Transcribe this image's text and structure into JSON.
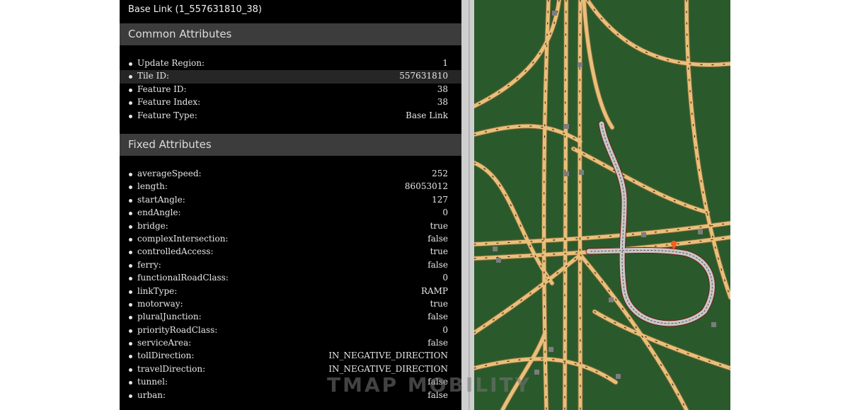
{
  "panel": {
    "title": "Base Link (1_557631810_38)",
    "common_section": "Common Attributes",
    "fixed_section": "Fixed Attributes",
    "common_attributes": [
      {
        "key": "Update Region:",
        "value": "1"
      },
      {
        "key": "Tile ID:",
        "value": "557631810"
      },
      {
        "key": "Feature ID:",
        "value": "38"
      },
      {
        "key": "Feature Index:",
        "value": "38"
      },
      {
        "key": "Feature Type:",
        "value": "Base Link"
      }
    ],
    "fixed_attributes": [
      {
        "key": "averageSpeed:",
        "value": "252"
      },
      {
        "key": "length:",
        "value": "86053012"
      },
      {
        "key": "startAngle:",
        "value": "127"
      },
      {
        "key": "endAngle:",
        "value": "0"
      },
      {
        "key": "bridge:",
        "value": "true"
      },
      {
        "key": "complexIntersection:",
        "value": "false"
      },
      {
        "key": "controlledAccess:",
        "value": "true"
      },
      {
        "key": "ferry:",
        "value": "false"
      },
      {
        "key": "functionalRoadClass:",
        "value": "0"
      },
      {
        "key": "linkType:",
        "value": "RAMP"
      },
      {
        "key": "motorway:",
        "value": "true"
      },
      {
        "key": "pluralJunction:",
        "value": "false"
      },
      {
        "key": "priorityRoadClass:",
        "value": "0"
      },
      {
        "key": "serviceArea:",
        "value": "false"
      },
      {
        "key": "tollDirection:",
        "value": "IN_NEGATIVE_DIRECTION"
      },
      {
        "key": "travelDirection:",
        "value": "IN_NEGATIVE_DIRECTION"
      },
      {
        "key": "tunnel:",
        "value": "false"
      },
      {
        "key": "urban:",
        "value": "false"
      }
    ]
  },
  "map": {
    "background_color": "#2a5a2c",
    "road_color": "#e9c07a",
    "selected_link_color": "#c8c8c8",
    "selected_outline_color": "#7a1a12",
    "marker_color": "#ff5a1f"
  },
  "watermark": "TMAP MOBILITY"
}
